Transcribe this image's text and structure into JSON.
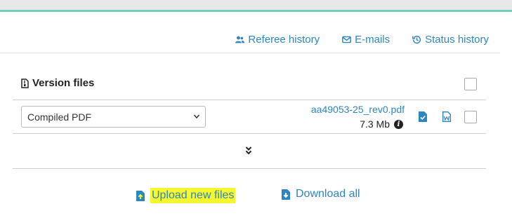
{
  "header": {
    "links": [
      {
        "label": "Referee history",
        "icon": "user-group-icon"
      },
      {
        "label": "E-mails",
        "icon": "envelope-icon"
      },
      {
        "label": "Status history",
        "icon": "history-icon"
      }
    ]
  },
  "version_files": {
    "title": "Version files",
    "row": {
      "type_select": "Compiled PDF",
      "file_name": "aa49053-25_rev0.pdf",
      "file_size": "7.3 Mb"
    }
  },
  "actions": {
    "upload_label": "Upload new files",
    "download_label": "Download all"
  },
  "colors": {
    "accent": "#2e86c1",
    "top_line": "#6fd0c4",
    "highlight": "#f7f730"
  }
}
